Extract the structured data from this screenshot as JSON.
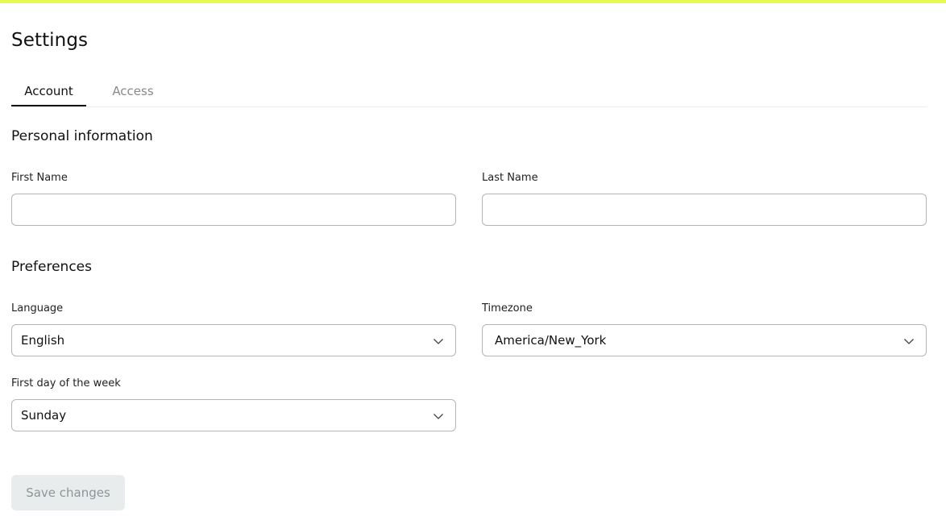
{
  "theme": {
    "accent": "#e6fb4f"
  },
  "page": {
    "title": "Settings"
  },
  "tabs": [
    {
      "label": "Account",
      "active": true
    },
    {
      "label": "Access",
      "active": false
    }
  ],
  "personal": {
    "title": "Personal information",
    "first_name": {
      "label": "First Name",
      "value": "",
      "placeholder": ""
    },
    "last_name": {
      "label": "Last Name",
      "value": "",
      "placeholder": ""
    }
  },
  "preferences": {
    "title": "Preferences",
    "language": {
      "label": "Language",
      "value": "English",
      "icon": "chevron-down-icon"
    },
    "timezone": {
      "label": "Timezone",
      "value": "America/New_York",
      "icon": "chevron-down-icon"
    },
    "first_day": {
      "label": "First day of the week",
      "value": "Sunday",
      "icon": "chevron-down-icon"
    }
  },
  "actions": {
    "save_label": "Save changes",
    "save_disabled": true
  }
}
